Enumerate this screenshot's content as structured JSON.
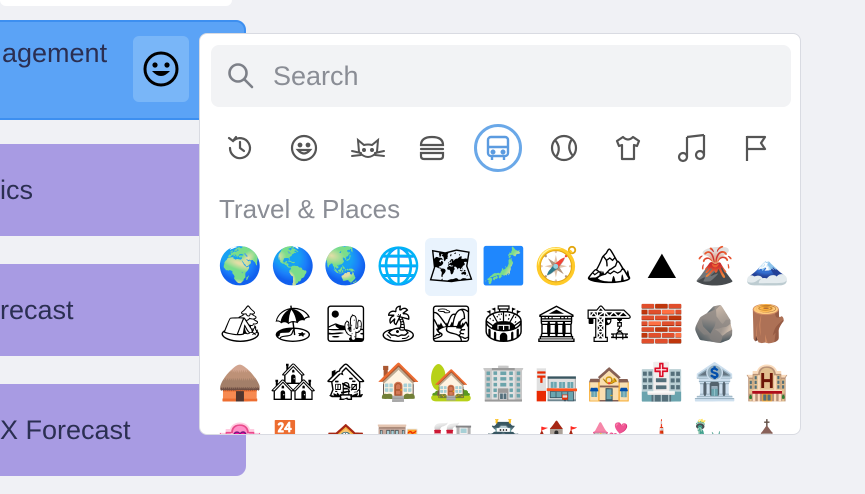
{
  "sidebar": {
    "cards": [
      {
        "label": "agement"
      },
      {
        "label": "ics"
      },
      {
        "label": "recast"
      },
      {
        "label": "X Forecast"
      }
    ]
  },
  "picker": {
    "search": {
      "placeholder": "Search",
      "value": ""
    },
    "categories": [
      {
        "name": "recent-icon"
      },
      {
        "name": "smileys-icon"
      },
      {
        "name": "animals-icon"
      },
      {
        "name": "food-icon"
      },
      {
        "name": "travel-icon",
        "active": true
      },
      {
        "name": "activities-icon"
      },
      {
        "name": "objects-icon"
      },
      {
        "name": "symbols-icon"
      },
      {
        "name": "flags-icon"
      }
    ],
    "section_title": "Travel & Places",
    "emojis": [
      "🌍",
      "🌎",
      "🌏",
      "🌐",
      "🗺",
      "🗾",
      "🧭",
      "🏔",
      "⛰",
      "🌋",
      "🗻",
      "🏕",
      "🏖",
      "🏜",
      "🏝",
      "🏞",
      "🏟",
      "🏛",
      "🏗",
      "🧱",
      "🪨",
      "🪵",
      "🛖",
      "🏘",
      "🏚",
      "🏠",
      "🏡",
      "🏢",
      "🏣",
      "🏤",
      "🏥",
      "🏦",
      "🏨",
      "🏩",
      "🏪",
      "🏫",
      "🏬",
      "🏭",
      "🏯",
      "🏰",
      "💒",
      "🗼",
      "🗽",
      "⛪"
    ]
  },
  "colors": {
    "active_card": "#5ba3f6",
    "purple_card": "#a89be3",
    "accent_ring": "#6aa8e8"
  }
}
